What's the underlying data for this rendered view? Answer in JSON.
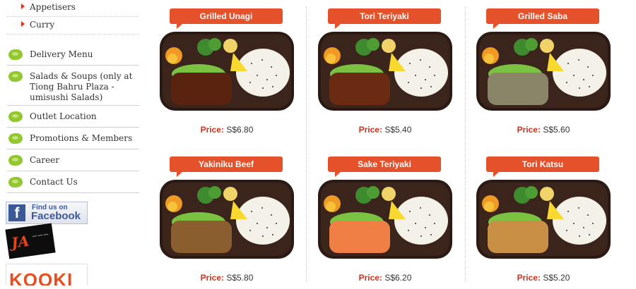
{
  "sidebar": {
    "sub_items": [
      {
        "label": "Appetisers"
      },
      {
        "label": "Curry"
      }
    ],
    "nav_items": [
      {
        "label": "Delivery Menu"
      },
      {
        "label": "Salads & Soups (only at Tiong Bahru Plaza - umisushi Salads)"
      },
      {
        "label": "Outlet Location"
      },
      {
        "label": "Promotions & Members"
      },
      {
        "label": "Career"
      },
      {
        "label": "Contact Us"
      }
    ],
    "facebook": {
      "letter": "f",
      "small": "Find us on",
      "big": "Facebook"
    },
    "ja_logo": {
      "text": "JA"
    },
    "bottom_logo": {
      "text": "KOOKI"
    }
  },
  "products": [
    {
      "name": "Grilled Unagi",
      "price_label": "Price:",
      "price": "S$6.80",
      "protein_color": "#5a2310"
    },
    {
      "name": "Tori Teriyaki",
      "price_label": "Price:",
      "price": "S$5.40",
      "protein_color": "#6b2a12"
    },
    {
      "name": "Grilled Saba",
      "price_label": "Price:",
      "price": "S$5.60",
      "protein_color": "#8a8468"
    },
    {
      "name": "Yakiniku Beef",
      "price_label": "Price:",
      "price": "S$5.80",
      "protein_color": "#8a5e2e"
    },
    {
      "name": "Sake Teriyaki",
      "price_label": "Price:",
      "price": "S$6.20",
      "protein_color": "#ef7f45"
    },
    {
      "name": "Tori Katsu",
      "price_label": "Price:",
      "price": "S$5.20",
      "protein_color": "#c98f45"
    }
  ],
  "colors": {
    "accent": "#e4512b",
    "price_label": "#c8331d",
    "leaf_icon": "#93c72f",
    "arrow": "#e2301b"
  }
}
